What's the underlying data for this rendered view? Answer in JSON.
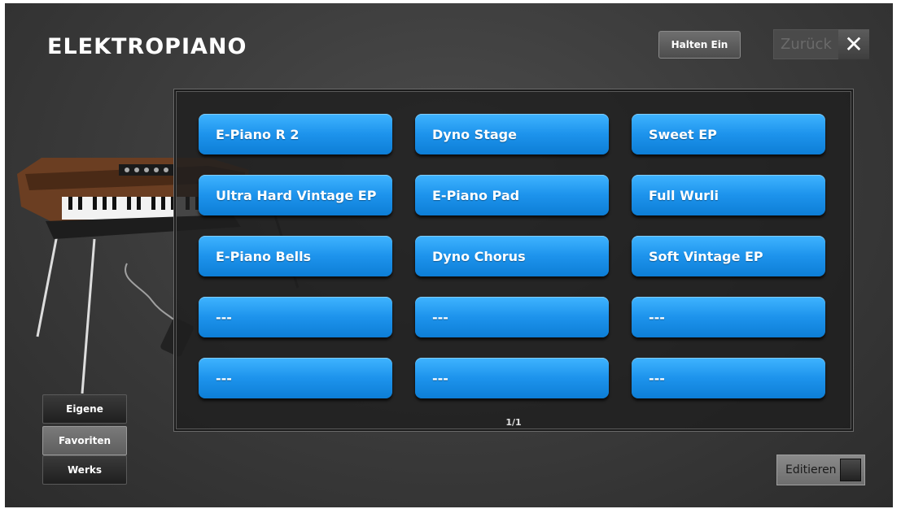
{
  "header": {
    "title": "ELEKTROPIANO",
    "hold_label": "Halten Ein",
    "back_label": "Zurück",
    "close_glyph": "✕"
  },
  "presets": [
    "E-Piano R 2",
    "Dyno Stage",
    "Sweet EP",
    "Ultra Hard Vintage EP",
    "E-Piano Pad",
    "Full Wurli",
    "E-Piano Bells",
    "Dyno Chorus",
    "Soft Vintage EP",
    "---",
    "---",
    "---",
    "---",
    "---",
    "---"
  ],
  "page_indicator": "1/1",
  "banks": {
    "eigene": "Eigene",
    "favoriten": "Favoriten",
    "werks": "Werks",
    "selected": "Favoriten"
  },
  "edit": {
    "label": "Editieren"
  },
  "colors": {
    "preset_blue": "#1d93ec",
    "background": "#3a3a3a"
  },
  "icons": {
    "close": "close-icon",
    "piano": "electric-piano-illustration"
  }
}
